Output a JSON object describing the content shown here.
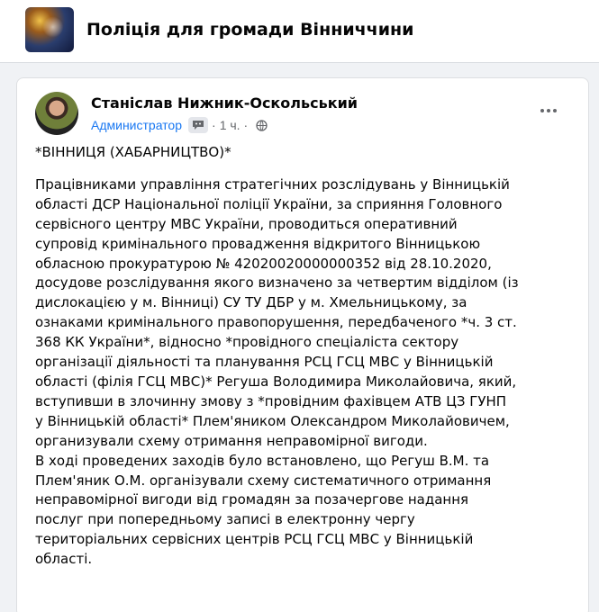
{
  "group": {
    "title": "Поліція для громади Вінниччини",
    "thumbnail_icon": "group-cover-photo"
  },
  "post": {
    "author": "Станіслав Нижник-Оскольський",
    "role": "Администратор",
    "role_badge_icon": "admin-badge-icon",
    "separator": "·",
    "time": "1 ч.",
    "privacy_icon": "globe-icon",
    "tag": "*ВІННИЦЯ (ХАБАРНИЦТВО)*",
    "lines": [
      "Працівниками управління стратегічних розслідувань у Вінницькій",
      "області ДСР Національної поліції України, за сприяння Головного",
      "сервісного центру МВС України, проводиться оперативний",
      "супровід кримінального провадження відкритого Вінницькою",
      "обласною прокуратурою № 42020020000000352 від 28.10.2020,",
      "досудове розслідування якого визначено за четвертим відділом (із",
      "дислокацією у м. Вінниці) СУ ТУ ДБР у м. Хмельницькому, за",
      "ознаками кримінального правопорушення, передбаченого *ч. 3 ст.",
      "368 КК України*, відносно *провідного спеціаліста сектору",
      "організації діяльності та планування РСЦ ГСЦ МВС у Вінницькій",
      "області (філія ГСЦ МВС)* Регуша Володимира Миколайовича, який,",
      "вступивши в злочинну змову з *провідним фахівцем АТВ ЦЗ ГУНП",
      "у Вінницькій області* Плем'яником Олександром Миколайовичем,",
      "организували схему отримання неправомірної вигоди.",
      "В ході проведених заходів було встановлено, що Регуш В.М. та",
      "Плем'яник О.М. організували схему систематичного отримання",
      "неправомірної вигоди від громадян за позачергове надання",
      "послуг при попередньому записі в електронну чергу",
      "територіальних сервісних центрів РСЦ ГСЦ МВС у Вінницькій",
      "області."
    ]
  },
  "colors": {
    "accent": "#1877f2",
    "page_background": "#f0f2f5",
    "text": "#050505",
    "secondary_text": "#65676b"
  }
}
